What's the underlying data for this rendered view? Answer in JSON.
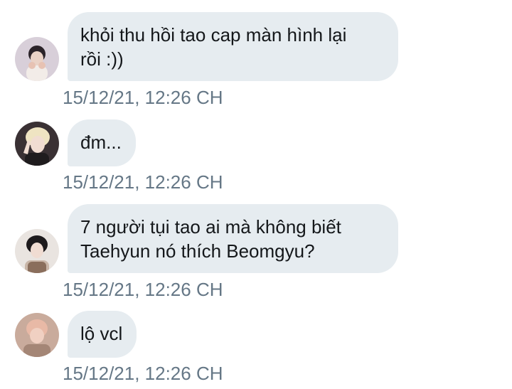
{
  "conversation": {
    "messages": [
      {
        "text": "khỏi thu hồi tao cap màn hình lại\nrồi :))",
        "timestamp": "15/12/21, 12:26 CH",
        "avatar": "user-avatar-1"
      },
      {
        "text": "đm...",
        "timestamp": "15/12/21, 12:26 CH",
        "avatar": "user-avatar-2"
      },
      {
        "text": "7 người tụi tao ai mà không biết\nTaehyun nó thích Beomgyu?",
        "timestamp": "15/12/21, 12:26 CH",
        "avatar": "user-avatar-3"
      },
      {
        "text": "lộ vcl",
        "timestamp": "15/12/21, 12:26 CH",
        "avatar": "user-avatar-4"
      }
    ]
  },
  "colors": {
    "bubble": "#e6ecf0",
    "text": "#14171a",
    "timestamp": "#657786",
    "background": "#ffffff"
  }
}
